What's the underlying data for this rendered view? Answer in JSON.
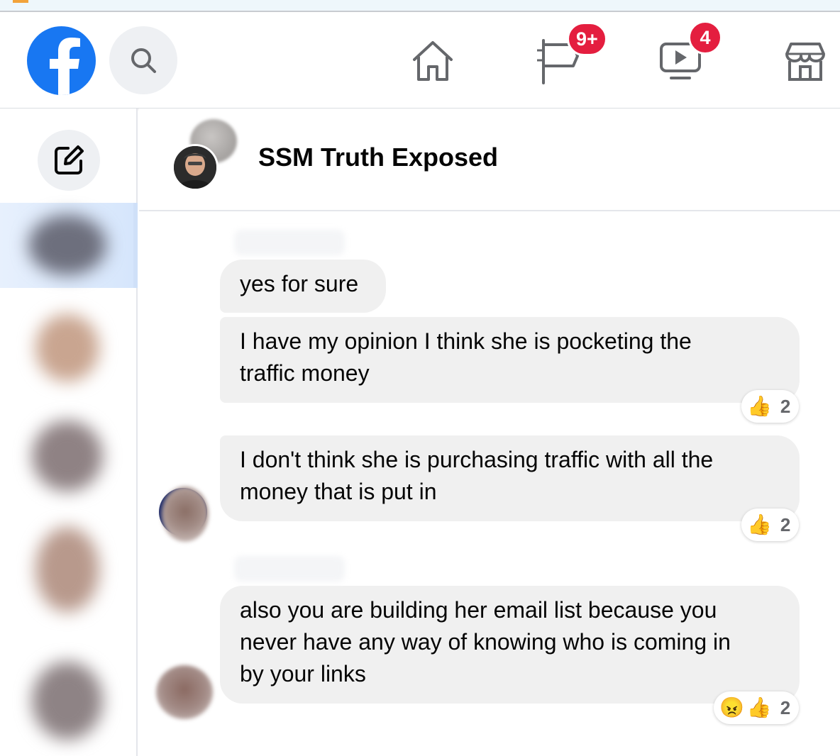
{
  "browser": {
    "icon": "tab-indicator"
  },
  "navbar": {
    "logo": "facebook-logo",
    "search_icon": "search-icon",
    "tabs": [
      {
        "name": "home",
        "icon": "home-icon",
        "badge": ""
      },
      {
        "name": "pages",
        "icon": "flag-icon",
        "badge": "9+"
      },
      {
        "name": "watch",
        "icon": "video-icon",
        "badge": "4"
      },
      {
        "name": "marketplace",
        "icon": "store-icon",
        "badge": ""
      }
    ]
  },
  "sidebar": {
    "compose_icon": "compose-icon"
  },
  "chat": {
    "title": "SSM Truth Exposed",
    "messages": [
      {
        "text": "yes for sure",
        "reactions": ""
      },
      {
        "line1": "I have my opinion I think she is pocketing the",
        "line2": "traffic money",
        "reaction_emoji": "👍",
        "reaction_count": "2"
      },
      {
        "line1": "I don't think she is purchasing traffic with all the",
        "line2": "money that is put in",
        "reaction_emoji": "👍",
        "reaction_count": "2"
      },
      {
        "line1": "also you are building her email list because you",
        "line2": "never have any way of knowing who is coming in",
        "line3": "by your links",
        "reaction_emoji1": "😠",
        "reaction_emoji2": "👍",
        "reaction_count": "2"
      }
    ]
  },
  "colors": {
    "brand": "#1877f2",
    "badge": "#e41e3f",
    "bubble": "#f0f0f0",
    "selected": "#e7f0fd"
  }
}
